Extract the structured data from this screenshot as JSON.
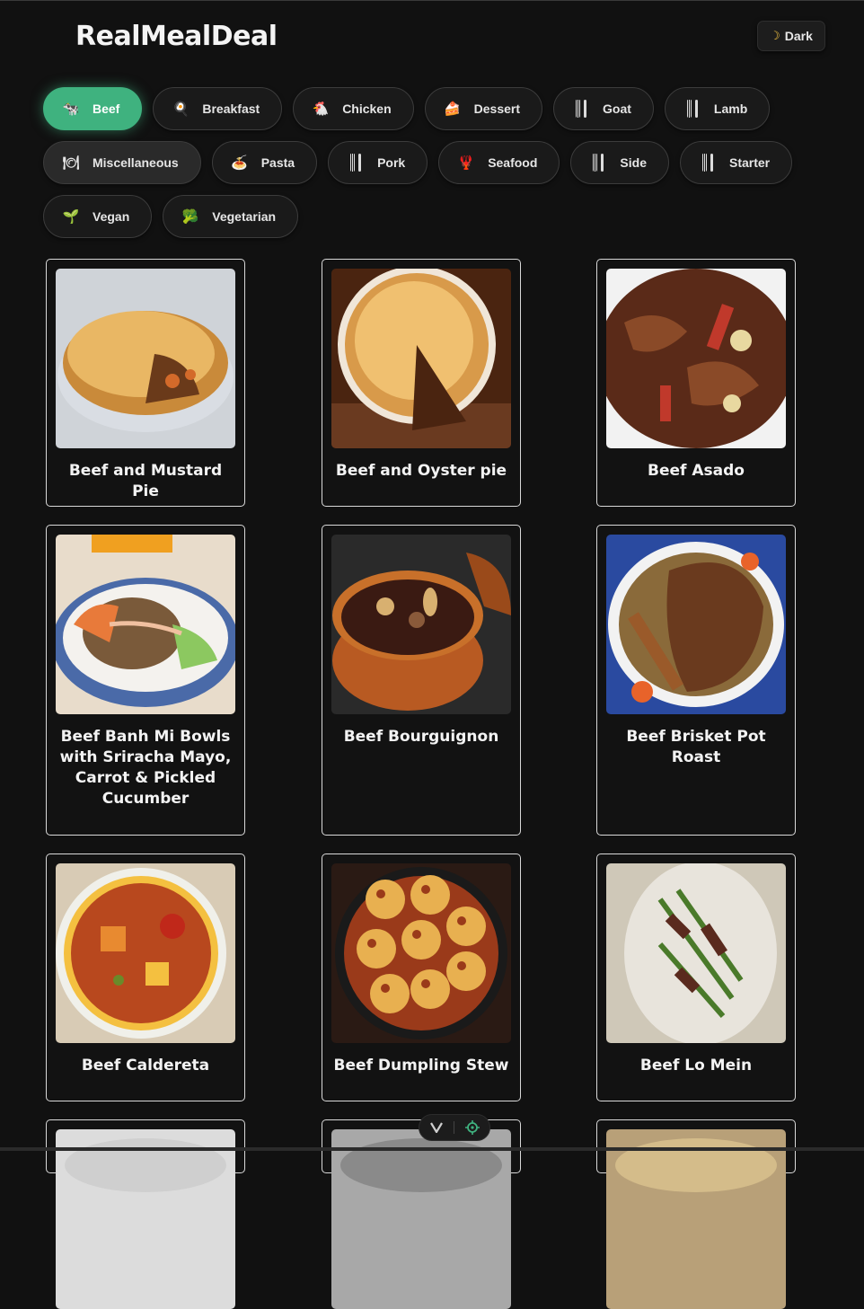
{
  "app": {
    "title": "RealMealDeal"
  },
  "theme_toggle": {
    "icon": "moon-icon",
    "label": "Dark"
  },
  "categories": [
    {
      "label": "Beef",
      "icon": "cow-icon",
      "emoji": "🐄",
      "active": true
    },
    {
      "label": "Breakfast",
      "icon": "frying-pan-icon",
      "emoji": "🍳"
    },
    {
      "label": "Chicken",
      "icon": "chicken-icon",
      "emoji": "🐔"
    },
    {
      "label": "Dessert",
      "icon": "cake-icon",
      "emoji": "🍰"
    },
    {
      "label": "Goat",
      "icon": "fork-knife-icon",
      "emoji": ""
    },
    {
      "label": "Lamb",
      "icon": "fork-knife-icon",
      "emoji": ""
    },
    {
      "label": "Miscellaneous",
      "icon": "plate-icon",
      "emoji": "🍽"
    },
    {
      "label": "Pasta",
      "icon": "spaghetti-icon",
      "emoji": "🍝"
    },
    {
      "label": "Pork",
      "icon": "fork-knife-icon",
      "emoji": ""
    },
    {
      "label": "Seafood",
      "icon": "lobster-icon",
      "emoji": "🦞"
    },
    {
      "label": "Side",
      "icon": "fork-knife-icon",
      "emoji": ""
    },
    {
      "label": "Starter",
      "icon": "fork-knife-icon",
      "emoji": ""
    },
    {
      "label": "Vegan",
      "icon": "seedling-icon",
      "emoji": "🌱"
    },
    {
      "label": "Vegetarian",
      "icon": "broccoli-icon",
      "emoji": "🥦"
    }
  ],
  "meals": [
    {
      "title": "Beef and Mustard Pie",
      "image": "pie",
      "colors": [
        "#c98a3a",
        "#e9b764",
        "#6a3a1a",
        "#d9dde3"
      ]
    },
    {
      "title": "Beef and Oyster pie",
      "image": "pie-slice",
      "colors": [
        "#d89a4a",
        "#f0c070",
        "#4a2410",
        "#7a4a2a"
      ]
    },
    {
      "title": "Beef Asado",
      "image": "stew",
      "colors": [
        "#5a2a18",
        "#8a4a28",
        "#c0392b",
        "#f2f2f2"
      ]
    },
    {
      "title": "Beef Banh Mi Bowls with Sriracha Mayo, Carrot & Pickled Cucumber",
      "image": "bowl",
      "colors": [
        "#7a5a3a",
        "#e87a3a",
        "#8cc860",
        "#4a6aa8"
      ]
    },
    {
      "title": "Beef Bourguignon",
      "image": "pot",
      "colors": [
        "#3a1a12",
        "#b85a22",
        "#d8b070",
        "#2a2a2a"
      ]
    },
    {
      "title": "Beef Brisket Pot Roast",
      "image": "platter",
      "colors": [
        "#6a3a1e",
        "#9a5a2a",
        "#e8632a",
        "#2a4aa0"
      ]
    },
    {
      "title": "Beef Caldereta",
      "image": "curry",
      "colors": [
        "#b8481e",
        "#e88a30",
        "#f4c040",
        "#f0f0ea"
      ]
    },
    {
      "title": "Beef Dumpling Stew",
      "image": "dumplings",
      "colors": [
        "#2a1a14",
        "#e8b050",
        "#9a3a1a",
        "#4a8a2a"
      ]
    },
    {
      "title": "Beef Lo Mein",
      "image": "noodles",
      "colors": [
        "#5a2a1e",
        "#4a7a2a",
        "#e8e4dc",
        "#b07a4a"
      ]
    },
    {
      "title": "",
      "image": "partial",
      "colors": [
        "#dcdcdc",
        "#cfcfcf",
        "#eeeeee",
        "#bbbbbb"
      ]
    },
    {
      "title": "",
      "image": "partial",
      "colors": [
        "#a8a8a8",
        "#8a8a8a",
        "#c8c8c8",
        "#777777"
      ]
    },
    {
      "title": "",
      "image": "partial",
      "colors": [
        "#b8a078",
        "#d4bc8a",
        "#8a6a40",
        "#e8d8b0"
      ]
    }
  ]
}
